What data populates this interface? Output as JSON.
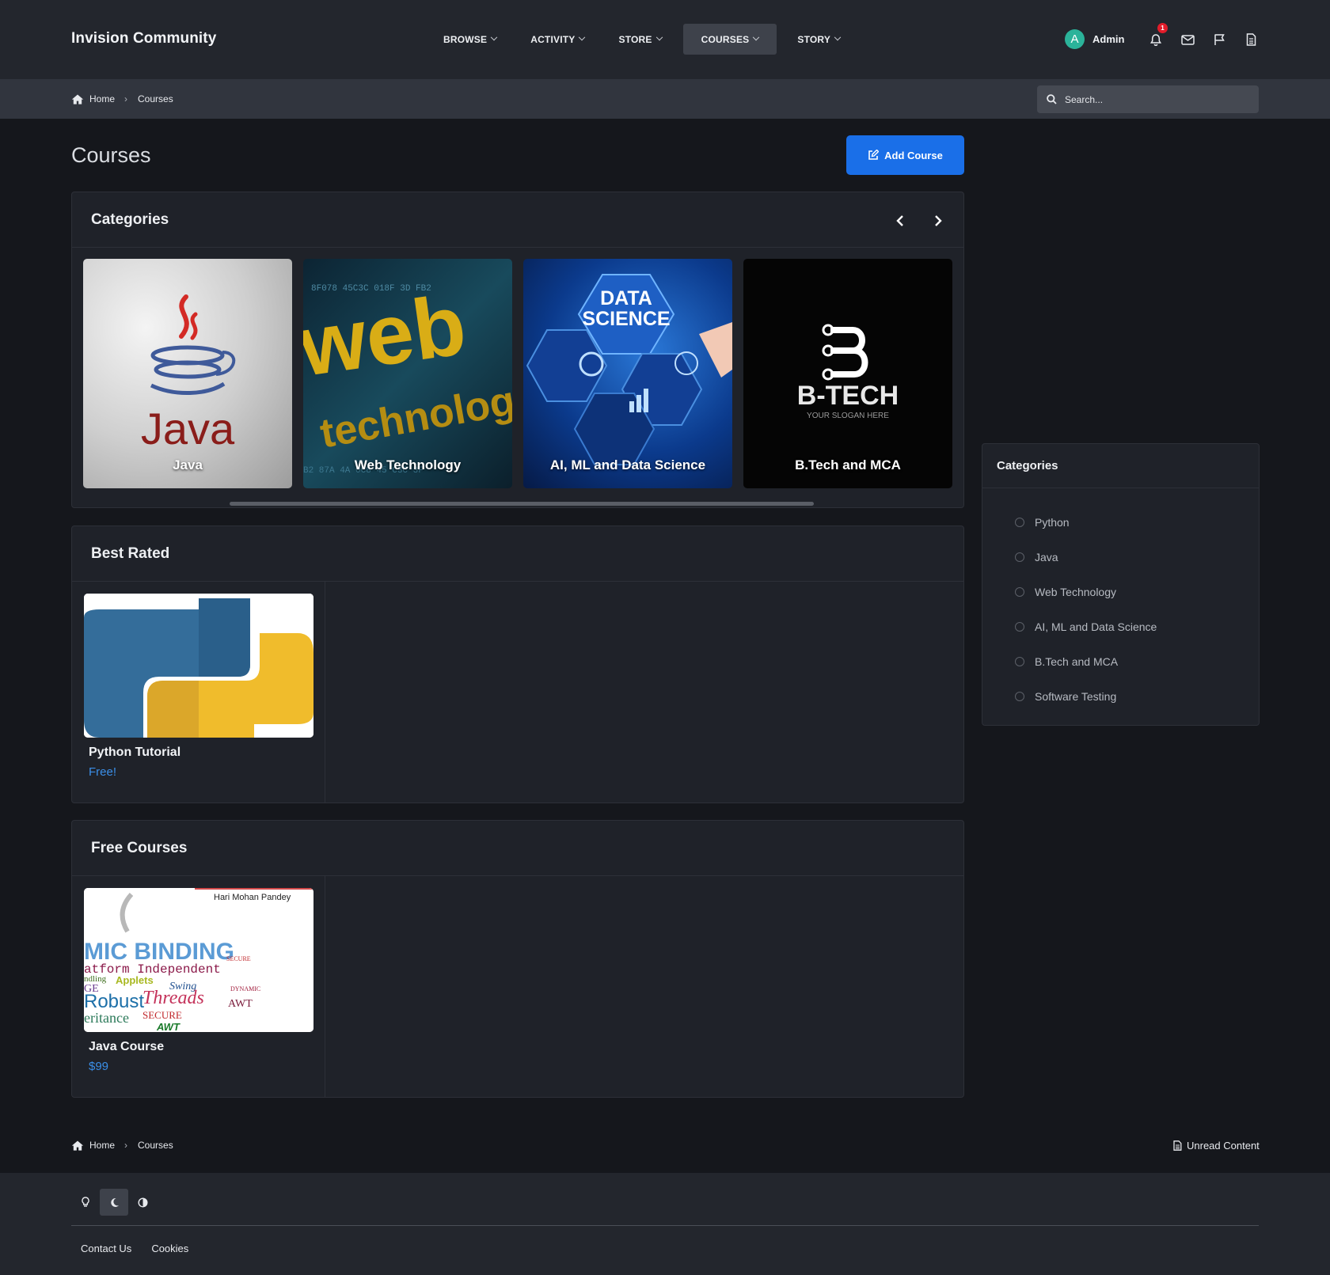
{
  "header": {
    "site_name": "Invision Community",
    "nav": [
      {
        "label": "BROWSE"
      },
      {
        "label": "ACTIVITY"
      },
      {
        "label": "STORE"
      },
      {
        "label": "COURSES",
        "active": true
      },
      {
        "label": "STORY"
      }
    ],
    "user": {
      "initial": "A",
      "name": "Admin"
    },
    "notification_count": "1",
    "icons": [
      "bell-icon",
      "envelope-icon",
      "flag-icon",
      "document-icon"
    ]
  },
  "breadcrumb": {
    "home": "Home",
    "current": "Courses"
  },
  "search": {
    "placeholder": "Search..."
  },
  "page": {
    "title": "Courses",
    "add_button": "Add Course"
  },
  "categories_panel": {
    "title": "Categories",
    "items": [
      {
        "label": "Java"
      },
      {
        "label": "Web Technology"
      },
      {
        "label": "AI, ML and Data Science"
      },
      {
        "label": "B.Tech and MCA"
      }
    ],
    "image_text": {
      "java_logo": "Java",
      "web_1": "web",
      "web_2": "technology",
      "ds_1": "DATA",
      "ds_2": "SCIENCE",
      "btech_title": "B-TECH",
      "btech_slogan": "YOUR SLOGAN HERE"
    }
  },
  "best_rated": {
    "title": "Best Rated",
    "course": {
      "name": "Python Tutorial",
      "price": "Free!"
    }
  },
  "free_courses": {
    "title": "Free Courses",
    "course": {
      "name": "Java Course",
      "price": "$99",
      "image_text": {
        "author": "Hari Mohan Pandey",
        "w1": "MIC BINDING",
        "w2": "atform Independent",
        "w3": "Robust",
        "w4": "Threads",
        "w5": "Applets",
        "w6": "Swing",
        "w7": "eritance",
        "w8": "SECURE",
        "w9": "AWT",
        "w10": "GE",
        "w11": "ndling"
      }
    }
  },
  "sidebar": {
    "title": "Categories",
    "items": [
      "Python",
      "Java",
      "Web Technology",
      "AI, ML and Data Science",
      "B.Tech and MCA",
      "Software Testing"
    ]
  },
  "bottom": {
    "breadcrumb_home": "Home",
    "breadcrumb_current": "Courses",
    "unread": "Unread Content"
  },
  "footer": {
    "links": [
      "Contact Us",
      "Cookies"
    ]
  },
  "colors": {
    "accent": "#1a6fe8",
    "price": "#3b8fe8",
    "badge": "#e21c2a"
  }
}
